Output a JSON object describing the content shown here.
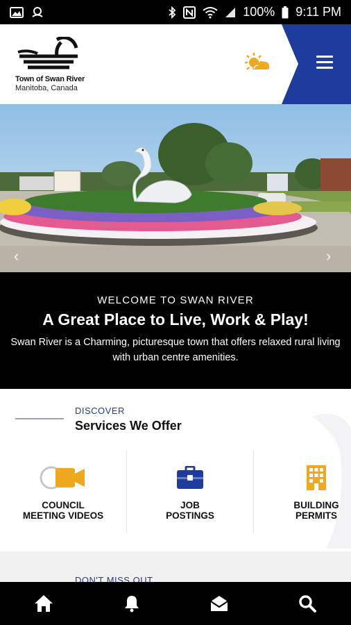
{
  "status_bar": {
    "battery_percent": "100%",
    "time": "9:11 PM",
    "icons": [
      "image-icon",
      "location-icon",
      "bluetooth-icon",
      "nfc-icon",
      "wifi-icon",
      "signal-icon",
      "battery-icon"
    ]
  },
  "header": {
    "logo_title": "Town of Swan River",
    "logo_subtitle": "Manitoba, Canada",
    "weather_icon": "sun-cloud-icon",
    "menu_icon": "hamburger-menu-icon",
    "accent_color": "#1e3c9e",
    "weather_color": "#f0a81f"
  },
  "hero": {
    "prev_icon": "chevron-left-icon",
    "next_icon": "chevron-right-icon"
  },
  "welcome": {
    "kicker": "WELCOME TO SWAN RIVER",
    "heading": "A Great Place to Live, Work & Play!",
    "description": "Swan River is a Charming, picturesque town that offers relaxed rural living with urban centre amenities."
  },
  "services": {
    "kicker": "DISCOVER",
    "title": "Services We Offer",
    "items": [
      {
        "line1": "COUNCIL",
        "line2": "MEETING VIDEOS",
        "icon": "video-camera-icon"
      },
      {
        "line1": "JOB",
        "line2": "POSTINGS",
        "icon": "briefcase-icon"
      },
      {
        "line1": "BUILDING",
        "line2": "PERMITS",
        "icon": "building-icon"
      }
    ]
  },
  "dont_miss": {
    "kicker": "DON'T MISS OUT"
  },
  "bottom_nav": {
    "items": [
      "home-icon",
      "bell-icon",
      "mail-icon",
      "search-icon"
    ]
  }
}
